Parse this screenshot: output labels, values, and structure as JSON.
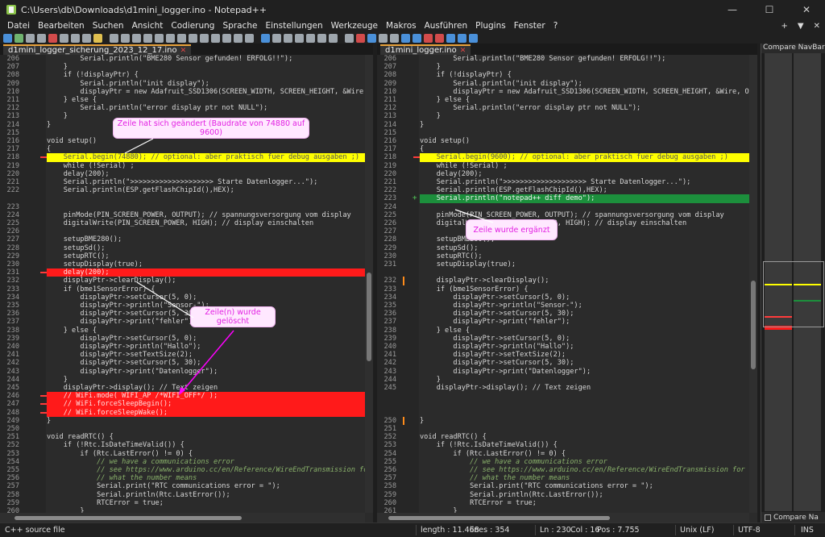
{
  "window": {
    "title": "C:\\Users\\db\\Downloads\\d1mini_logger.ino - Notepad++",
    "minimize": "—",
    "maximize": "☐",
    "close": "✕"
  },
  "menu": [
    "Datei",
    "Bearbeiten",
    "Suchen",
    "Ansicht",
    "Codierung",
    "Sprache",
    "Einstellungen",
    "Werkzeuge",
    "Makros",
    "Ausführen",
    "Plugins",
    "Fenster",
    "?"
  ],
  "menu_right": [
    "+",
    "▼",
    "✕"
  ],
  "left_pane": {
    "tab": "d1mini_logger_sicherung_2023_12_17.ino",
    "lines": [
      {
        "n": "206",
        "t": "        Serial.println(\"BME280 Sensor gefunden! ERFOLG!!\");"
      },
      {
        "n": "207",
        "t": "    }"
      },
      {
        "n": "208",
        "t": "    if (!displayPtr) {"
      },
      {
        "n": "209",
        "t": "        Serial.println(\"init display\");"
      },
      {
        "n": "210",
        "t": "        displayPtr = new Adafruit_SSD1306(SCREEN_WIDTH, SCREEN_HEIGHT, &Wire, OLE"
      },
      {
        "n": "211",
        "t": "    } else {"
      },
      {
        "n": "212",
        "t": "        Serial.println(\"error display ptr not NULL\");"
      },
      {
        "n": "213",
        "t": "    }"
      },
      {
        "n": "214",
        "t": "}"
      },
      {
        "n": "215",
        "t": ""
      },
      {
        "n": "216",
        "t": "void setup()"
      },
      {
        "n": "217",
        "t": "{"
      },
      {
        "n": "218",
        "t": "    Serial.begin(74880); // optional: aber praktisch fuer debug ausgaben ;)",
        "hl": "yellow",
        "mark": true
      },
      {
        "n": "219",
        "t": "    while (!Serial) ;"
      },
      {
        "n": "220",
        "t": "    delay(200);"
      },
      {
        "n": "221",
        "t": "    Serial.println(\">>>>>>>>>>>>>>>>>>>> Starte Datenlogger...\");"
      },
      {
        "n": "222",
        "t": "    Serial.println(ESP.getFlashChipId(),HEX);"
      },
      {
        "n": "",
        "t": "",
        "hl": "lgrey"
      },
      {
        "n": "223",
        "t": ""
      },
      {
        "n": "224",
        "t": "    pinMode(PIN_SCREEN_POWER, OUTPUT); // spannungsversorgung vom display"
      },
      {
        "n": "225",
        "t": "    digitalWrite(PIN_SCREEN_POWER, HIGH); // display einschalten"
      },
      {
        "n": "226",
        "t": ""
      },
      {
        "n": "227",
        "t": "    setupBME280();"
      },
      {
        "n": "228",
        "t": "    setupSd();"
      },
      {
        "n": "229",
        "t": "    setupRTC();"
      },
      {
        "n": "230",
        "t": "    setupDisplay(true);"
      },
      {
        "n": "231",
        "t": "    delay(200);",
        "hl": "red",
        "mark": true
      },
      {
        "n": "232",
        "t": "    displayPtr->clearDisplay();"
      },
      {
        "n": "233",
        "t": "    if (bme1SensorError) {"
      },
      {
        "n": "234",
        "t": "        displayPtr->setCursor(5, 0);"
      },
      {
        "n": "235",
        "t": "        displayPtr->println(\"Sensor-\");"
      },
      {
        "n": "236",
        "t": "        displayPtr->setCursor(5, 30);"
      },
      {
        "n": "237",
        "t": "        displayPtr->print(\"fehler\");"
      },
      {
        "n": "238",
        "t": "    } else {"
      },
      {
        "n": "239",
        "t": "        displayPtr->setCursor(5, 0);"
      },
      {
        "n": "240",
        "t": "        displayPtr->println(\"Hallo\");"
      },
      {
        "n": "241",
        "t": "        displayPtr->setTextSize(2);"
      },
      {
        "n": "242",
        "t": "        displayPtr->setCursor(5, 30);"
      },
      {
        "n": "243",
        "t": "        displayPtr->print(\"Datenlogger\");"
      },
      {
        "n": "244",
        "t": "    }"
      },
      {
        "n": "245",
        "t": "    displayPtr->display(); // Text zeigen"
      },
      {
        "n": "246",
        "t": "    // WiFi.mode( WIFI_AP /*WIFI_OFF*/ );",
        "hl": "red",
        "mark": true
      },
      {
        "n": "247",
        "t": "    // WiFi.forceSleepBegin();",
        "hl": "red",
        "mark": true
      },
      {
        "n": "248",
        "t": "    // WiFi.forceSleepWake();",
        "hl": "red",
        "mark": true
      },
      {
        "n": "249",
        "t": "}"
      },
      {
        "n": "250",
        "t": ""
      },
      {
        "n": "251",
        "t": "void readRTC() {"
      },
      {
        "n": "252",
        "t": "    if (!Rtc.IsDateTimeValid()) {"
      },
      {
        "n": "253",
        "t": "        if (Rtc.LastError() != 0) {"
      },
      {
        "n": "254",
        "t": "            // we have a communications error"
      },
      {
        "n": "255",
        "t": "            // see https://www.arduino.cc/en/Reference/WireEndTransmission for"
      },
      {
        "n": "256",
        "t": "            // what the number means"
      },
      {
        "n": "257",
        "t": "            Serial.print(\"RTC communications error = \");"
      },
      {
        "n": "258",
        "t": "            Serial.println(Rtc.LastError());"
      },
      {
        "n": "259",
        "t": "            RTCError = true;"
      },
      {
        "n": "260",
        "t": "        }"
      }
    ]
  },
  "right_pane": {
    "tab": "d1mini_logger.ino",
    "lines": [
      {
        "n": "206",
        "t": "        Serial.println(\"BME280 Sensor gefunden! ERFOLG!!\");"
      },
      {
        "n": "207",
        "t": "    }"
      },
      {
        "n": "208",
        "t": "    if (!displayPtr) {"
      },
      {
        "n": "209",
        "t": "        Serial.println(\"init display\");"
      },
      {
        "n": "210",
        "t": "        displayPtr = new Adafruit_SSD1306(SCREEN_WIDTH, SCREEN_HEIGHT, &Wire, OLED_R"
      },
      {
        "n": "211",
        "t": "    } else {"
      },
      {
        "n": "212",
        "t": "        Serial.println(\"error display ptr not NULL\");"
      },
      {
        "n": "213",
        "t": "    }"
      },
      {
        "n": "214",
        "t": "}"
      },
      {
        "n": "215",
        "t": ""
      },
      {
        "n": "216",
        "t": "void setup()"
      },
      {
        "n": "217",
        "t": "{"
      },
      {
        "n": "218",
        "t": "    Serial.begin(9600); // optional: aber praktisch fuer debug ausgaben ;)",
        "hl": "yellow",
        "mark": true
      },
      {
        "n": "219",
        "t": "    while (!Serial) ;"
      },
      {
        "n": "220",
        "t": "    delay(200);"
      },
      {
        "n": "221",
        "t": "    Serial.println(\">>>>>>>>>>>>>>>>>>>> Starte Datenlogger...\");"
      },
      {
        "n": "222",
        "t": "    Serial.println(ESP.getFlashChipId(),HEX);"
      },
      {
        "n": "223",
        "t": "    Serial.println(\"notepad++ diff demo\");",
        "hl": "green",
        "plus": true
      },
      {
        "n": "224",
        "t": ""
      },
      {
        "n": "225",
        "t": "    pinMode(PIN_SCREEN_POWER, OUTPUT); // spannungsversorgung vom display"
      },
      {
        "n": "226",
        "t": "    digitalWrite(PIN_SCREEN_POWER, HIGH); // display einschalten"
      },
      {
        "n": "227",
        "t": ""
      },
      {
        "n": "228",
        "t": "    setupBME280();"
      },
      {
        "n": "229",
        "t": "    setupSd();"
      },
      {
        "n": "230",
        "t": "    setupRTC();"
      },
      {
        "n": "231",
        "t": "    setupDisplay(true);"
      },
      {
        "n": "",
        "t": "",
        "hl": "lgrey"
      },
      {
        "n": "232",
        "t": "    displayPtr->clearDisplay();",
        "orange": true
      },
      {
        "n": "233",
        "t": "    if (bme1SensorError) {"
      },
      {
        "n": "234",
        "t": "        displayPtr->setCursor(5, 0);"
      },
      {
        "n": "235",
        "t": "        displayPtr->println(\"Sensor-\");"
      },
      {
        "n": "236",
        "t": "        displayPtr->setCursor(5, 30);"
      },
      {
        "n": "237",
        "t": "        displayPtr->print(\"fehler\");"
      },
      {
        "n": "238",
        "t": "    } else {"
      },
      {
        "n": "239",
        "t": "        displayPtr->setCursor(5, 0);"
      },
      {
        "n": "240",
        "t": "        displayPtr->println(\"Hallo\");"
      },
      {
        "n": "241",
        "t": "        displayPtr->setTextSize(2);"
      },
      {
        "n": "242",
        "t": "        displayPtr->setCursor(5, 30);"
      },
      {
        "n": "243",
        "t": "        displayPtr->print(\"Datenlogger\");"
      },
      {
        "n": "244",
        "t": "    }"
      },
      {
        "n": "245",
        "t": "    displayPtr->display(); // Text zeigen"
      },
      {
        "n": "",
        "t": "",
        "hl": "lgrey"
      },
      {
        "n": "",
        "t": "",
        "hl": "lgrey"
      },
      {
        "n": "",
        "t": "",
        "hl": "lgrey"
      },
      {
        "n": "250",
        "t": "}",
        "orange": true
      },
      {
        "n": "251",
        "t": ""
      },
      {
        "n": "252",
        "t": "void readRTC() {"
      },
      {
        "n": "253",
        "t": "    if (!Rtc.IsDateTimeValid()) {"
      },
      {
        "n": "254",
        "t": "        if (Rtc.LastError() != 0) {"
      },
      {
        "n": "255",
        "t": "            // we have a communications error"
      },
      {
        "n": "256",
        "t": "            // see https://www.arduino.cc/en/Reference/WireEndTransmission for"
      },
      {
        "n": "257",
        "t": "            // what the number means"
      },
      {
        "n": "258",
        "t": "            Serial.print(\"RTC communications error = \");"
      },
      {
        "n": "259",
        "t": "            Serial.println(Rtc.LastError());"
      },
      {
        "n": "260",
        "t": "            RTCError = true;"
      },
      {
        "n": "261",
        "t": "        }"
      }
    ]
  },
  "callouts": {
    "changed": "Zeile hat sich geändert (Baudrate von 74880 auf 9600)",
    "deleted": "Zeile(n) wurde gelöscht",
    "added": "Zeile wurde ergänzt"
  },
  "navbar": {
    "title": "Compare NavBar",
    "tab": "Compare Na"
  },
  "status": {
    "lang": "C++ source file",
    "length": "length : 11.468",
    "lines": "lines : 354",
    "ln": "Ln : 230",
    "col": "Col : 16",
    "pos": "Pos : 7.755",
    "eol": "Unix (LF)",
    "enc": "UTF-8",
    "mode": "INS"
  },
  "colors": {
    "changed": "#ffff00",
    "deleted": "#ff1a1a",
    "added": "#1c8f3c",
    "callout_text": "#e21fe2"
  }
}
